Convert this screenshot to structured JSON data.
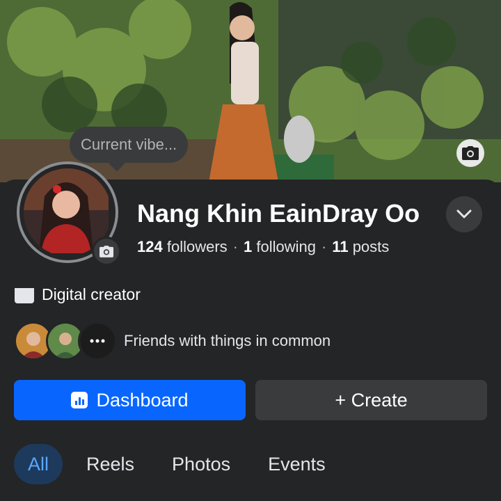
{
  "cover": {
    "camera_icon": "camera-icon"
  },
  "profile": {
    "current_vibe": "Current vibe...",
    "name": "Nang Khin EainDray Oo",
    "followers_count": "124",
    "followers_label": "followers",
    "following_count": "1",
    "following_label": "following",
    "posts_count": "11",
    "posts_label": "posts",
    "separator": "·",
    "category": "Digital creator"
  },
  "friends": {
    "text": "Friends with things in common"
  },
  "actions": {
    "dashboard_label": "Dashboard",
    "create_label": "+ Create"
  },
  "tabs": [
    {
      "label": "All",
      "active": true
    },
    {
      "label": "Reels",
      "active": false
    },
    {
      "label": "Photos",
      "active": false
    },
    {
      "label": "Events",
      "active": false
    }
  ],
  "colors": {
    "accent": "#0866ff",
    "background": "#242526",
    "surface": "#3a3b3c"
  }
}
